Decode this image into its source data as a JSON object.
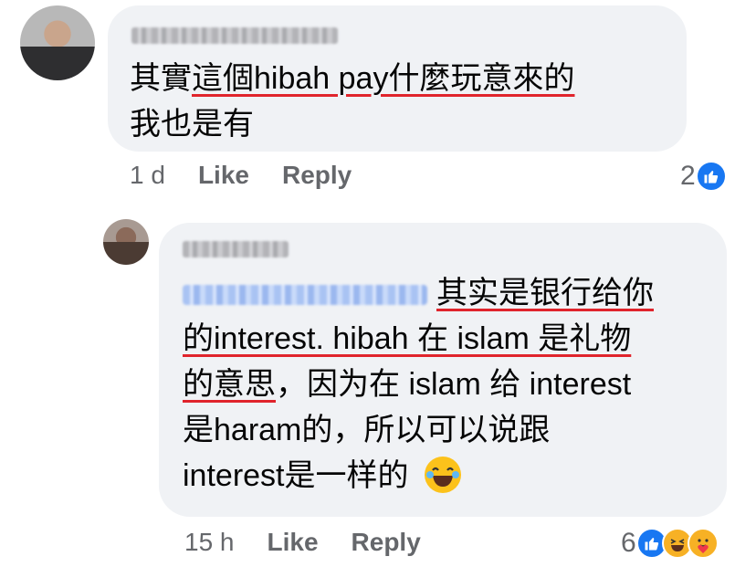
{
  "comment1": {
    "text_plain1": "其實",
    "text_ul": "這個hibah pay什麼玩意來的",
    "line2": "我也是有",
    "time": "1 d",
    "like_label": "Like",
    "reply_label": "Reply",
    "reaction_count": "2",
    "reaction_icons": [
      "like-icon"
    ]
  },
  "comment2": {
    "line1_ul": "其实是银行给你",
    "line2_ul": "的interest. hibah 在 islam 是礼物",
    "line3_ul": "的意思",
    "line3_rest": "，因为在 islam 给 interest",
    "line4": "是haram的，所以可以说跟",
    "line5": "interest是一样的",
    "time": "15 h",
    "like_label": "Like",
    "reply_label": "Reply",
    "reaction_count": "6",
    "reaction_icons": [
      "like-icon",
      "haha-icon",
      "care-icon"
    ]
  },
  "colors": {
    "bubble": "#f0f2f5",
    "underline": "#e0242c",
    "meta": "#65676b",
    "like_blue": "#1877f2"
  }
}
